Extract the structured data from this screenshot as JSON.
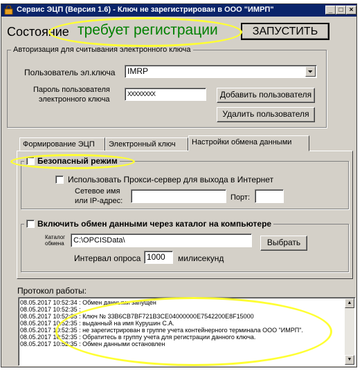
{
  "window": {
    "title": "Сервис ЭЦП (Версия 1.6) - Ключ не зарегистрирован в ООО \"ИМРП\"",
    "minimize": "_",
    "maximize": "□",
    "close": "×"
  },
  "status": {
    "label": "Состояние",
    "value": "требует регистрации",
    "value_color": "#008000",
    "start_button": "ЗАПУСТИТЬ"
  },
  "auth": {
    "group_title": "Авторизация для считывания электронного ключа",
    "user_label": "Пользователь эл.ключа",
    "user_value": "IMRP",
    "password_label_1": "Пароль пользователя",
    "password_label_2": "электронного ключа",
    "password_value": "XXXXXXXX",
    "add_user_button": "Добавить пользователя",
    "delete_user_button": "Удалить пользователя"
  },
  "tabs": [
    {
      "label": "Формирование ЭЦП",
      "active": false
    },
    {
      "label": "Электронный ключ",
      "active": false
    },
    {
      "label": "Настройки обмена данными",
      "active": true
    }
  ],
  "exchange": {
    "safe_mode_label": "Безопасный режим",
    "proxy_label": "Использовать Прокси-сервер для выхода в Интернет",
    "host_label_1": "Сетевое имя",
    "host_label_2": "или IP-адрес:",
    "host_value": "",
    "port_label": "Порт:",
    "port_value": "",
    "catalog_exchange_label": "Включить обмен данными через каталог на компьютере",
    "catalog_label_1": "Каталог",
    "catalog_label_2": "обмена",
    "catalog_value": "C:\\OPCISData\\",
    "browse_button": "Выбрать",
    "interval_label": "Интервал опроса",
    "interval_value": "1000",
    "interval_unit": "милисекунд"
  },
  "log": {
    "label": "Протокол работы:",
    "lines": [
      "08.05.2017 10:52:34 : Обмен данными запущен",
      "08.05.2017 10:52:35 :",
      "08.05.2017 10:52:35 : Ключ № 33B6CB7BF721B3CE04000000E7542200E8F15000",
      "08.05.2017 10:52:35 : выданный на имя Курушин С.А.",
      "08.05.2017 10:52:35 : не зарегистрирован в группе учета контейнерного терминала ООО \"ИМРП\".",
      "08.05.2017 10:52:35 : Обратитесь в группу учета для регистрации данного ключа.",
      "08.05.2017 10:52:35 : Обмен данными остановлен"
    ]
  },
  "annotation_color": "#ffff33"
}
